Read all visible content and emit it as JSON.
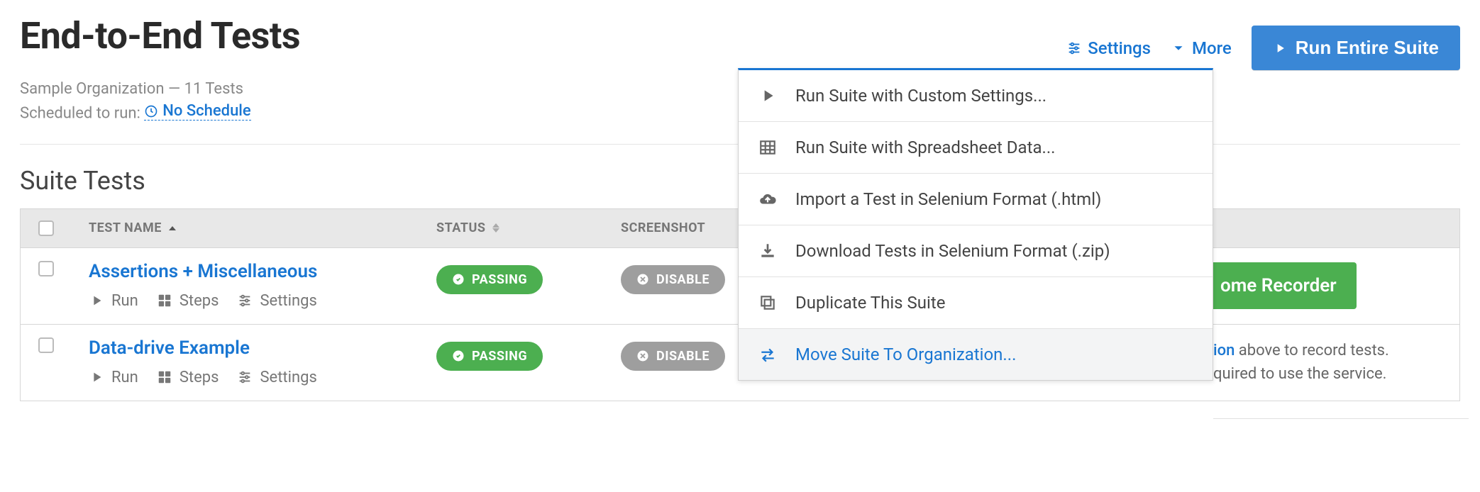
{
  "header": {
    "title": "End-to-End Tests",
    "settings_label": "Settings",
    "more_label": "More",
    "run_button": "Run Entire Suite"
  },
  "meta": {
    "org": "Sample Organization",
    "tests_count": "11 Tests",
    "schedule_label": "Scheduled to run:",
    "schedule_value": "No Schedule"
  },
  "section_title": "Suite Tests",
  "columns": {
    "name": "TEST NAME",
    "status": "STATUS",
    "screenshot": "SCREENSHOT"
  },
  "rows": [
    {
      "name": "Assertions + Miscellaneous",
      "status": "PASSING",
      "screenshot": "DISABLE",
      "actions": {
        "run": "Run",
        "steps": "Steps",
        "settings": "Settings"
      }
    },
    {
      "name": "Data-drive Example",
      "status": "PASSING",
      "screenshot": "DISABLE",
      "actions": {
        "run": "Run",
        "steps": "Steps",
        "settings": "Settings"
      }
    }
  ],
  "dropdown": [
    "Run Suite with Custom Settings...",
    "Run Suite with Spreadsheet Data...",
    "Import a Test in Selenium Format (.html)",
    "Download Tests in Selenium Format (.zip)",
    "Duplicate This Suite",
    "Move Suite To Organization..."
  ],
  "side": {
    "recorder": "ome Recorder",
    "hint_link": "ion",
    "hint_1": " above to record tests.",
    "hint_2": "quired to use the service."
  }
}
